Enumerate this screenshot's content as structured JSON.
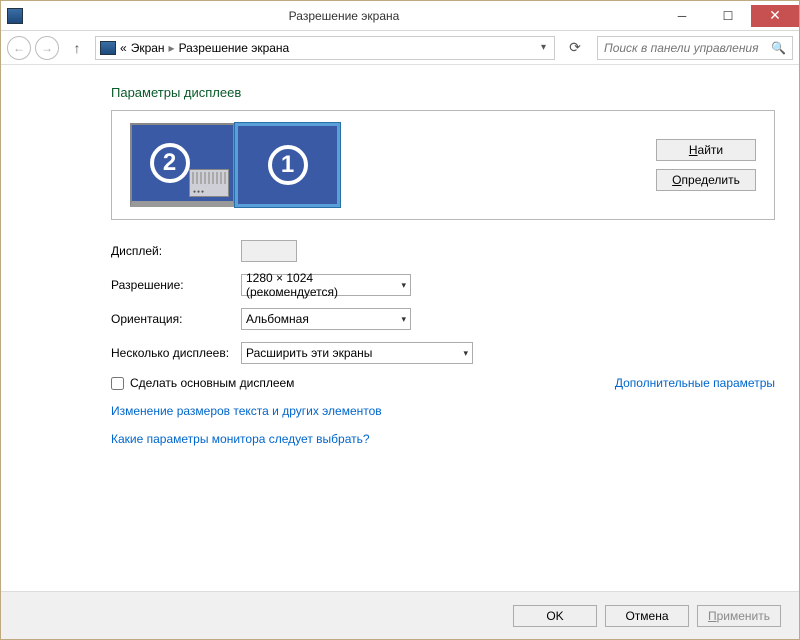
{
  "title": "Разрешение экрана",
  "breadcrumb": {
    "prefix": "«",
    "item1": "Экран",
    "item2": "Разрешение экрана"
  },
  "search": {
    "placeholder": "Поиск в панели управления"
  },
  "heading": "Параметры дисплеев",
  "monitors": {
    "left_num": "2",
    "right_num": "1"
  },
  "buttons": {
    "find": "Найти",
    "detect": "Определить"
  },
  "labels": {
    "display": "Дисплей:",
    "resolution": "Разрешение:",
    "orientation": "Ориентация:",
    "multiple": "Несколько дисплеев:"
  },
  "values": {
    "resolution": "1280 × 1024 (рекомендуется)",
    "orientation": "Альбомная",
    "multiple": "Расширить эти экраны"
  },
  "checkbox": "Сделать основным дисплеем",
  "adv_link": "Дополнительные параметры",
  "link1": "Изменение размеров текста и других элементов",
  "link2": "Какие параметры монитора следует выбрать?",
  "footer": {
    "ok": "OK",
    "cancel": "Отмена",
    "apply": "Применить"
  }
}
